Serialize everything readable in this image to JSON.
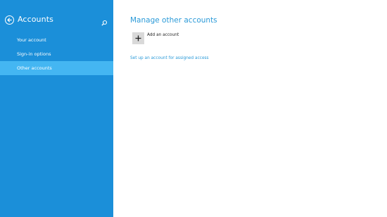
{
  "sidebar": {
    "title": "Accounts",
    "back_icon": "back-arrow-icon",
    "search_icon": "search-icon",
    "items": [
      {
        "label": "Your account",
        "selected": false
      },
      {
        "label": "Sign-in options",
        "selected": false
      },
      {
        "label": "Other accounts",
        "selected": true
      }
    ]
  },
  "main": {
    "title": "Manage other accounts",
    "add_account_label": "Add an account",
    "add_icon": "plus-icon",
    "assigned_access_link": "Set up an account for assigned access"
  },
  "colors": {
    "sidebar_background": "#1b8fd9",
    "selected_item": "#44b6f2",
    "accent_text": "#2b9ad8",
    "tile_background": "#d9d9d9"
  }
}
